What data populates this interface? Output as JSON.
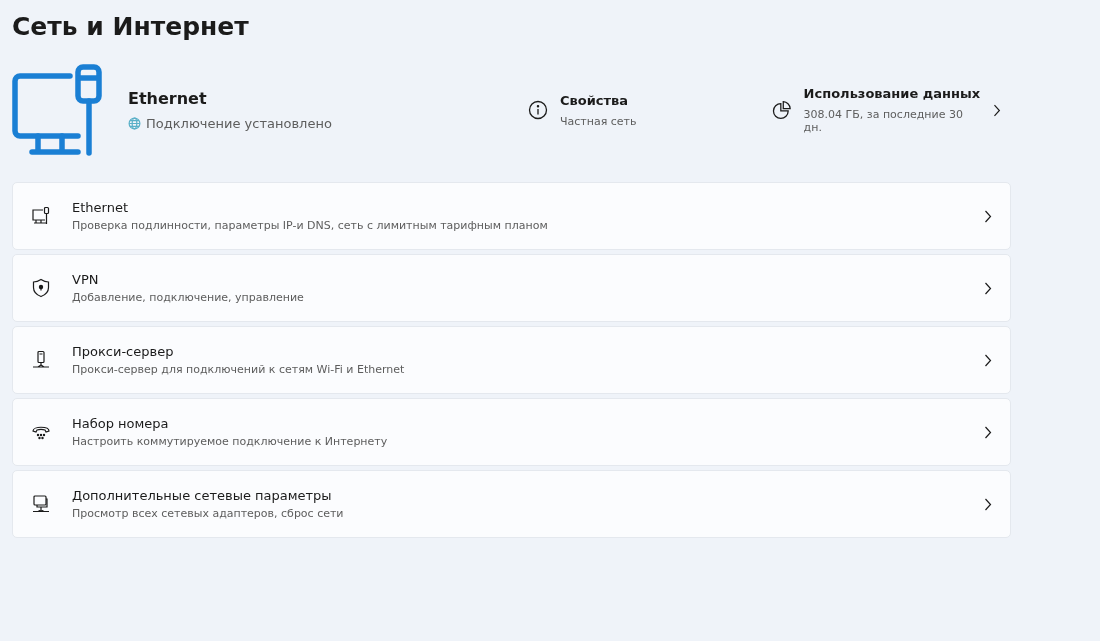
{
  "page_title": "Сеть и Интернет",
  "connection": {
    "name": "Ethernet",
    "status": "Подключение установлено"
  },
  "properties": {
    "title": "Свойства",
    "subtitle": "Частная сеть"
  },
  "data_usage": {
    "title": "Использование данных",
    "subtitle": "308.04 ГБ, за последние 30 дн."
  },
  "items": [
    {
      "kind": "ethernet",
      "title": "Ethernet",
      "subtitle": "Проверка подлинности, параметры IP-и DNS, сеть с лимитным тарифным планом"
    },
    {
      "kind": "vpn",
      "title": "VPN",
      "subtitle": "Добавление, подключение, управление"
    },
    {
      "kind": "proxy",
      "title": "Прокси-сервер",
      "subtitle": "Прокси-сервер для подключений к сетям Wi-Fi и Ethernet"
    },
    {
      "kind": "dialup",
      "title": "Набор номера",
      "subtitle": "Настроить коммутируемое подключение к Интернету"
    },
    {
      "kind": "advanced",
      "title": "Дополнительные сетевые параметры",
      "subtitle": "Просмотр всех сетевых адаптеров, сброс сети"
    }
  ]
}
